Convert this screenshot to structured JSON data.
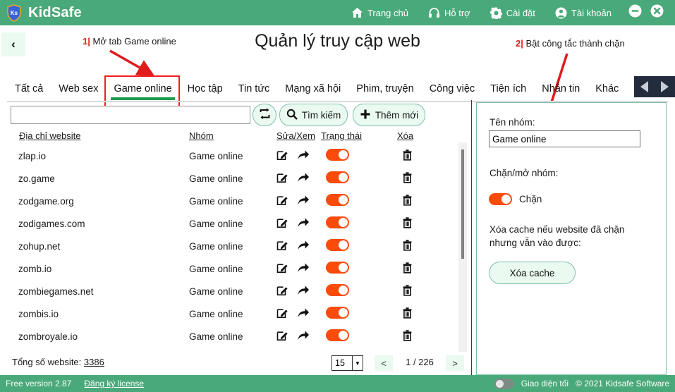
{
  "app": {
    "brand": "KidSafe",
    "logo_icon": "shield-ks-icon",
    "page_title": "Quản lý truy cập web"
  },
  "topnav": [
    {
      "label": "Trang chủ",
      "icon": "home-icon"
    },
    {
      "label": "Hỗ trợ",
      "icon": "headset-icon"
    },
    {
      "label": "Cài đặt",
      "icon": "gear-icon"
    },
    {
      "label": "Tài khoản",
      "icon": "user-circle-icon"
    }
  ],
  "window_controls": {
    "minimize_icon": "minimize-circle-icon",
    "close_icon": "close-circle-icon"
  },
  "back_button": {
    "label": "‹",
    "icon": "chevron-left-icon"
  },
  "annotations": [
    {
      "num": "1|",
      "text": "Mở tab Game online"
    },
    {
      "num": "2|",
      "text": "Bật công tắc thành chặn"
    }
  ],
  "tabs": [
    {
      "label": "Tất cả",
      "active": false
    },
    {
      "label": "Web sex",
      "active": false
    },
    {
      "label": "Game online",
      "active": true
    },
    {
      "label": "Học tập",
      "active": false
    },
    {
      "label": "Tin  tức",
      "active": false
    },
    {
      "label": "Mạng xã hội",
      "active": false
    },
    {
      "label": "Phim, truyện",
      "active": false
    },
    {
      "label": "Công việc",
      "active": false
    },
    {
      "label": "Tiện ích",
      "active": false
    },
    {
      "label": "Nhắn tin",
      "active": false
    },
    {
      "label": "Khác",
      "active": false
    }
  ],
  "tab_add_label": "+",
  "tab_nav": {
    "prev_icon": "triangle-left-icon",
    "next_icon": "triangle-right-icon"
  },
  "toolbar": {
    "search_value": "",
    "search_placeholder": "",
    "refresh_icon": "refresh-sync-icon",
    "search_label": "Tìm kiếm",
    "search_icon": "magnifier-icon",
    "add_label": "Thêm mới",
    "add_icon": "plus-icon"
  },
  "table": {
    "columns": [
      "Địa chỉ website",
      "Nhóm",
      "Sửa/Xem",
      "Trạng thái",
      "Xóa"
    ],
    "row_icons": {
      "edit": "edit-pencil-icon",
      "share": "arrow-forward-icon",
      "status": "toggle-on-icon",
      "delete": "trash-icon"
    },
    "rows": [
      {
        "site": "zlap.io",
        "group": "Game online",
        "enabled": true
      },
      {
        "site": "zo.game",
        "group": "Game online",
        "enabled": true
      },
      {
        "site": "zodgame.org",
        "group": "Game online",
        "enabled": true
      },
      {
        "site": "zodigames.com",
        "group": "Game online",
        "enabled": true
      },
      {
        "site": "zohup.net",
        "group": "Game online",
        "enabled": true
      },
      {
        "site": "zomb.io",
        "group": "Game online",
        "enabled": true
      },
      {
        "site": "zombiegames.net",
        "group": "Game online",
        "enabled": true
      },
      {
        "site": "zombis.io",
        "group": "Game online",
        "enabled": true
      },
      {
        "site": "zombroyale.io",
        "group": "Game online",
        "enabled": true
      }
    ]
  },
  "footer": {
    "total_label": "Tổng số website:",
    "total_value": "3386",
    "page_size": "15",
    "prev_label": "<",
    "next_label": ">",
    "page_info": "1  /  226"
  },
  "right_panel": {
    "group_name_label": "Tên nhóm:",
    "group_name_value": "Game online",
    "block_label": "Chặn/mở nhóm:",
    "block_state": "Chặn",
    "block_enabled": true,
    "cache_line1": "Xóa cache nếu website đã chặn",
    "cache_line2": "nhưng vẫn vào được:",
    "cache_button": "Xóa cache"
  },
  "statusbar": {
    "version": "Free version 2.87",
    "license_link": "Đăng ký license",
    "dark_mode_label": "Giao diện tối",
    "dark_mode_on": false,
    "copyright": "© 2021 Kidsafe Software"
  },
  "colors": {
    "header_green": "#4aa97a",
    "accent_orange": "#fb4b0a",
    "tab_underline_green": "#1a9e4b",
    "annotation_red": "#f21f1f",
    "mint_button": "#eafaf0",
    "teal_border": "#7fbfae"
  }
}
